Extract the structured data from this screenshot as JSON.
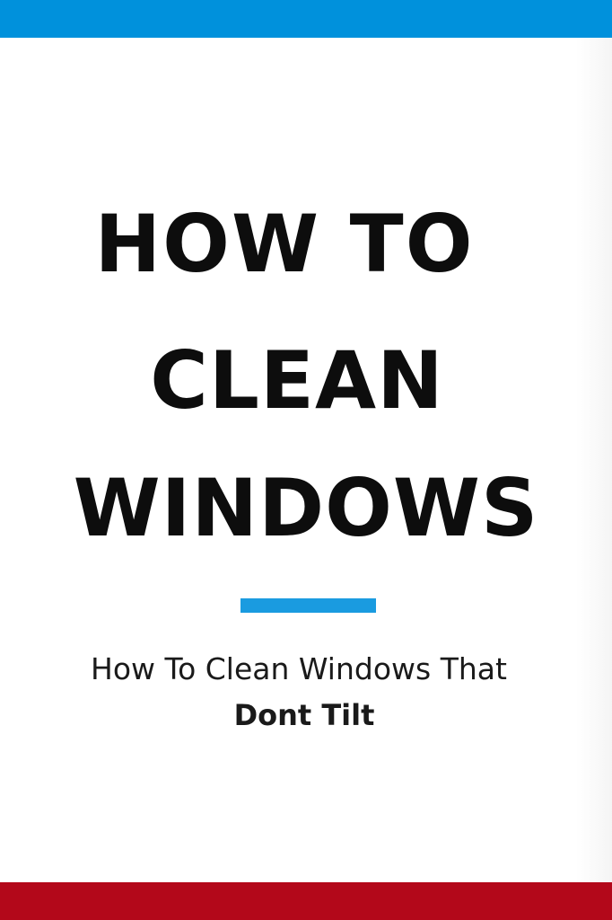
{
  "colors": {
    "top_bar": "#0091dc",
    "bottom_bar": "#b3081a",
    "accent_rule": "#1a9be0",
    "title_text": "#0d0d0d",
    "background": "#ffffff"
  },
  "title": {
    "lines": [
      "HOW TO",
      "CLEAN",
      "WINDOWS"
    ]
  },
  "subtitle": {
    "line_1": "How To Clean Windows That",
    "line_2": "Dont Tilt"
  }
}
